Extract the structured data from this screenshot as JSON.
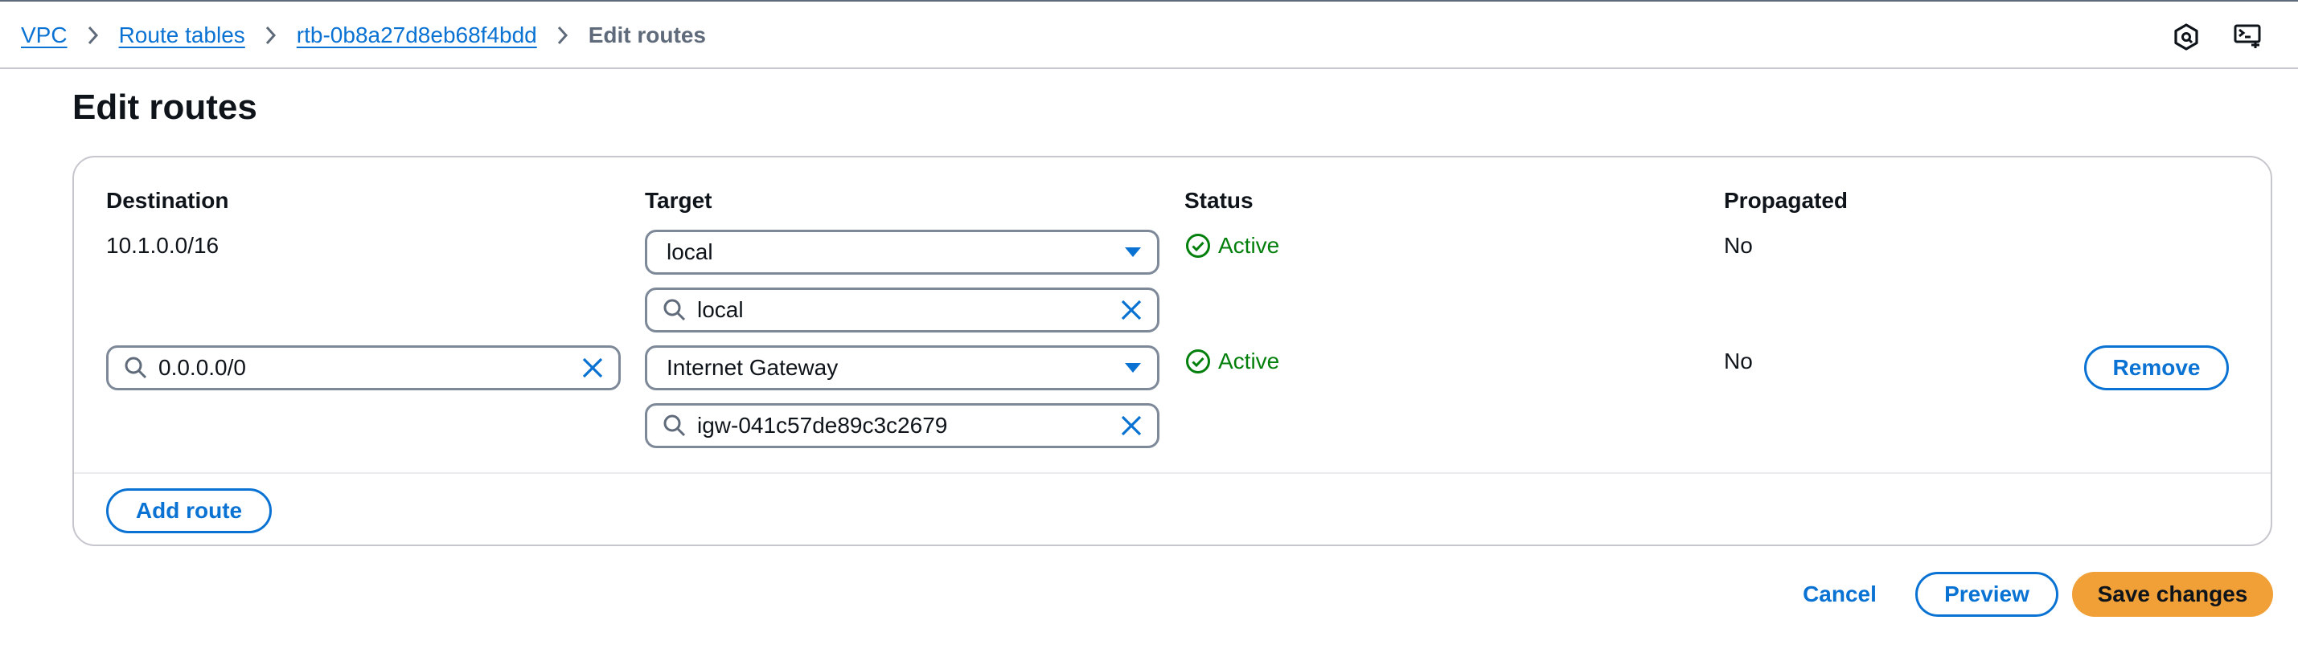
{
  "breadcrumb": {
    "items": [
      {
        "label": "VPC"
      },
      {
        "label": "Route tables"
      },
      {
        "label": "rtb-0b8a27d8eb68f4bdd"
      }
    ],
    "current": "Edit routes"
  },
  "page": {
    "title": "Edit routes"
  },
  "table": {
    "headers": {
      "destination": "Destination",
      "target": "Target",
      "status": "Status",
      "propagated": "Propagated"
    },
    "rows": [
      {
        "destination": "10.1.0.0/16",
        "target_select": "local",
        "target_search": "local",
        "status": "Active",
        "propagated": "No"
      },
      {
        "destination_input": "0.0.0.0/0",
        "target_select": "Internet Gateway",
        "target_search": "igw-041c57de89c3c2679",
        "status": "Active",
        "propagated": "No",
        "remove_label": "Remove"
      }
    ]
  },
  "actions": {
    "add_route": "Add route",
    "cancel": "Cancel",
    "preview": "Preview",
    "save": "Save changes"
  },
  "colors": {
    "link": "#0972d3",
    "status_active": "#037f0c",
    "primary_button": "#f0a037",
    "border": "#7d8998"
  },
  "icons": {
    "breadcrumb_separator": "chevron-right-icon",
    "top_right_1": "settings-hexagon-icon",
    "top_right_2": "cloudshell-icon",
    "select_caret": "caret-down-icon",
    "search": "search-icon",
    "clear": "close-icon",
    "status": "status-success-icon"
  }
}
